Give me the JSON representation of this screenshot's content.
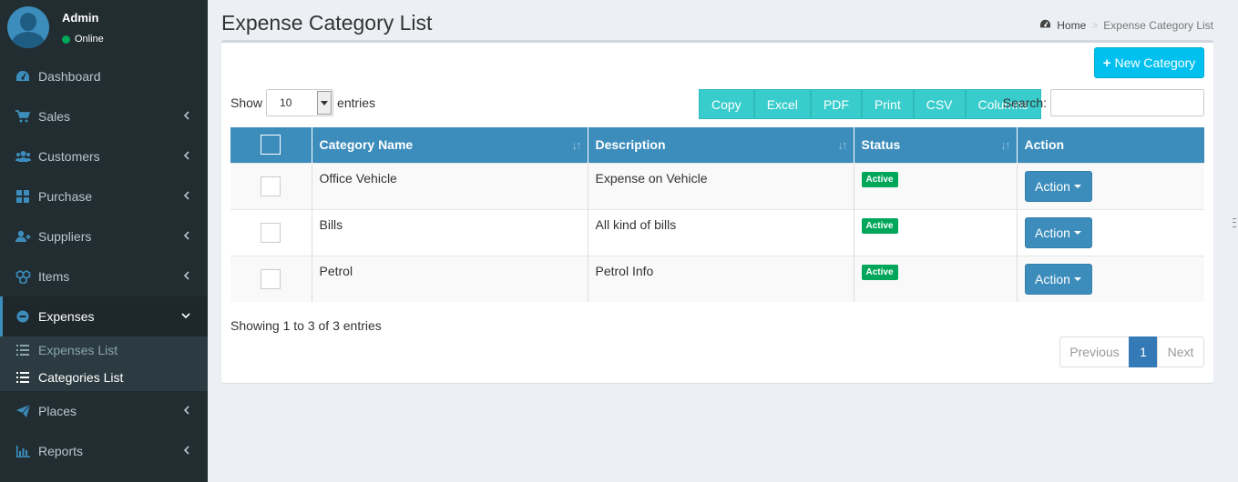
{
  "user": {
    "name": "Admin",
    "status": "Online"
  },
  "sidebar": {
    "items": [
      {
        "label": "Dashboard",
        "icon": "dashboard-icon"
      },
      {
        "label": "Sales",
        "icon": "cart-icon"
      },
      {
        "label": "Customers",
        "icon": "users-icon"
      },
      {
        "label": "Purchase",
        "icon": "grid-icon"
      },
      {
        "label": "Suppliers",
        "icon": "user-plus-icon"
      },
      {
        "label": "Items",
        "icon": "cubes-icon"
      },
      {
        "label": "Expenses",
        "icon": "minus-circle-icon"
      },
      {
        "label": "Places",
        "icon": "paper-plane-icon"
      },
      {
        "label": "Reports",
        "icon": "bar-chart-icon"
      }
    ],
    "submenu": [
      {
        "label": "Expenses List"
      },
      {
        "label": "Categories List"
      }
    ]
  },
  "page": {
    "title": "Expense Category List",
    "breadcrumb": {
      "home": "Home",
      "current": "Expense Category List"
    }
  },
  "toolbar": {
    "new_button": "New Category",
    "show_label": "Show",
    "entries_label": "entries",
    "length_value": "10",
    "search_label": "Search:",
    "search_value": "",
    "export_buttons": [
      "Copy",
      "Excel",
      "PDF",
      "Print",
      "CSV",
      "Columns"
    ]
  },
  "table": {
    "headers": [
      "Category Name",
      "Description",
      "Status",
      "Action"
    ],
    "rows": [
      {
        "name": "Office Vehicle",
        "description": "Expense on Vehicle",
        "status": "Active",
        "action": "Action"
      },
      {
        "name": "Bills",
        "description": "All kind of bills",
        "status": "Active",
        "action": "Action"
      },
      {
        "name": "Petrol",
        "description": "Petrol Info",
        "status": "Active",
        "action": "Action"
      }
    ]
  },
  "footer": {
    "info": "Showing 1 to 3 of 3 entries",
    "pagination": {
      "previous": "Previous",
      "current": "1",
      "next": "Next"
    }
  },
  "colors": {
    "sidebar_bg": "#222d32",
    "table_header": "#3c8dbc",
    "new_button": "#00c0ef",
    "export_button": "#39cccc",
    "status_active": "#00a65a",
    "pagination_active": "#337ab7"
  }
}
